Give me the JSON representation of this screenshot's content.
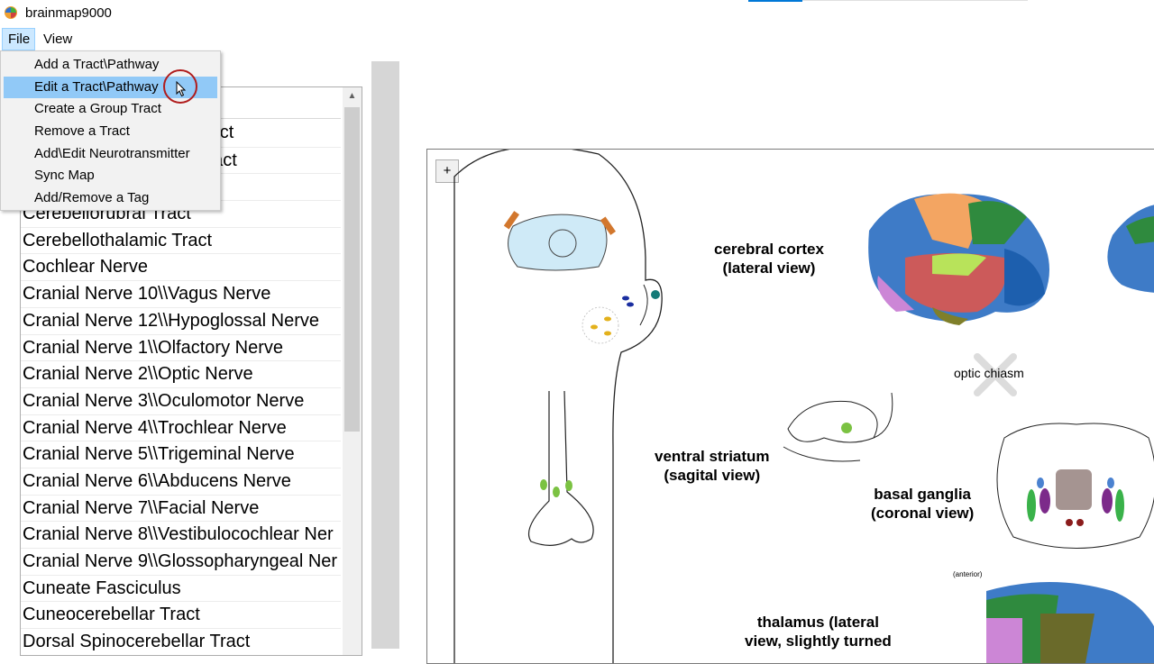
{
  "window": {
    "title": "brainmap9000",
    "app_icon": "brain-app-icon"
  },
  "menubar": {
    "file": "File",
    "view": "View"
  },
  "file_menu": {
    "items": [
      "Add a Tract\\Pathway",
      "Edit a Tract\\Pathway",
      "Create a Group Tract",
      "Remove a Tract",
      "Add\\Edit Neurotransmitter",
      "Sync Map",
      "Add/Remove a Tag"
    ],
    "hovered_index": 1
  },
  "tract_list": {
    "partial_items": [
      "ract",
      "Tract"
    ],
    "items": [
      "Cerebellorubral Tract",
      "Cerebellothalamic Tract",
      "Cochlear Nerve",
      "Cranial Nerve 10\\\\Vagus Nerve",
      "Cranial Nerve 12\\\\Hypoglossal Nerve",
      "Cranial Nerve 1\\\\Olfactory Nerve",
      "Cranial Nerve 2\\\\Optic Nerve",
      "Cranial Nerve 3\\\\Oculomotor Nerve",
      "Cranial Nerve 4\\\\Trochlear Nerve",
      "Cranial Nerve 5\\\\Trigeminal Nerve",
      "Cranial Nerve 6\\\\Abducens Nerve",
      "Cranial Nerve 7\\\\Facial Nerve",
      "Cranial Nerve 8\\\\Vestibulocochlear Ner",
      "Cranial Nerve 9\\\\Glossopharyngeal Ner",
      "Cuneate Fasciculus",
      "Cuneocerebellar Tract",
      "Dorsal Spinocerebellar Tract"
    ]
  },
  "map": {
    "zoom_button": "+",
    "labels": {
      "cortex": "cerebral cortex\n(lateral view)",
      "optic": "optic chiasm",
      "striatum": "ventral striatum\n(sagital view)",
      "basal": "basal ganglia\n(coronal view)",
      "anterior": "(anterior)",
      "thalamus": "thalamus (lateral\nview, slightly turned"
    }
  },
  "colors": {
    "menu_hover": "#91c9f7",
    "menu_active": "#cce8ff",
    "cursor_ring": "#b01c1c"
  }
}
